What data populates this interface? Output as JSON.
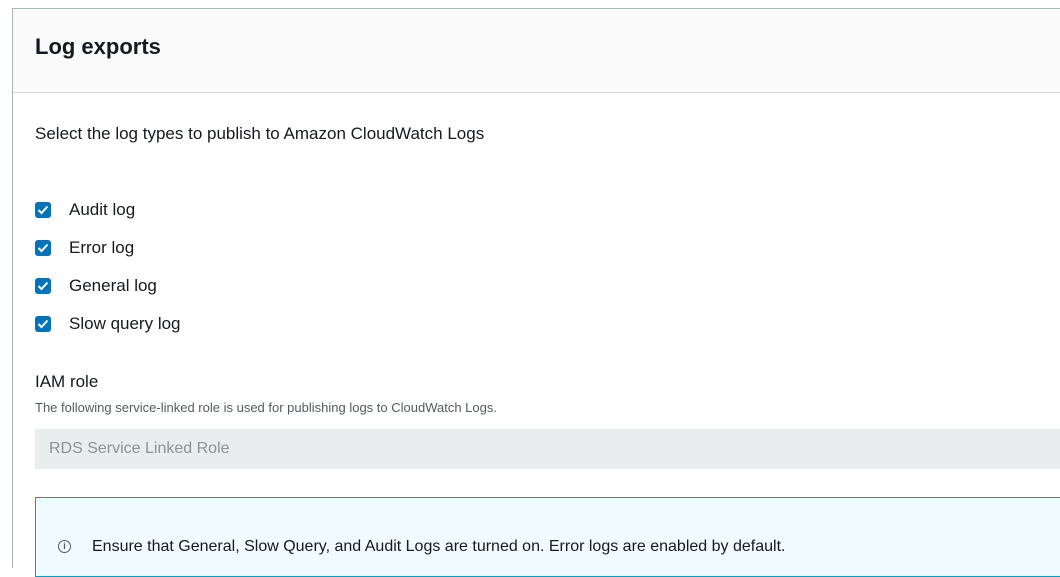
{
  "panel": {
    "title": "Log exports"
  },
  "description": "Select the log types to publish to Amazon CloudWatch Logs",
  "log_types": [
    {
      "label": "Audit log",
      "checked": true
    },
    {
      "label": "Error log",
      "checked": true
    },
    {
      "label": "General log",
      "checked": true
    },
    {
      "label": "Slow query log",
      "checked": true
    }
  ],
  "iam_role": {
    "label": "IAM role",
    "description": "The following service-linked role is used for publishing logs to CloudWatch Logs.",
    "value": "RDS Service Linked Role"
  },
  "info_alert": {
    "icon": "info-icon",
    "text": "Ensure that General, Slow Query, and Audit Logs are turned on. Error logs are enabled by default."
  },
  "colors": {
    "checkbox": "#0073bb",
    "info_border": "#00a1c9",
    "input_bg": "#eaeded"
  }
}
